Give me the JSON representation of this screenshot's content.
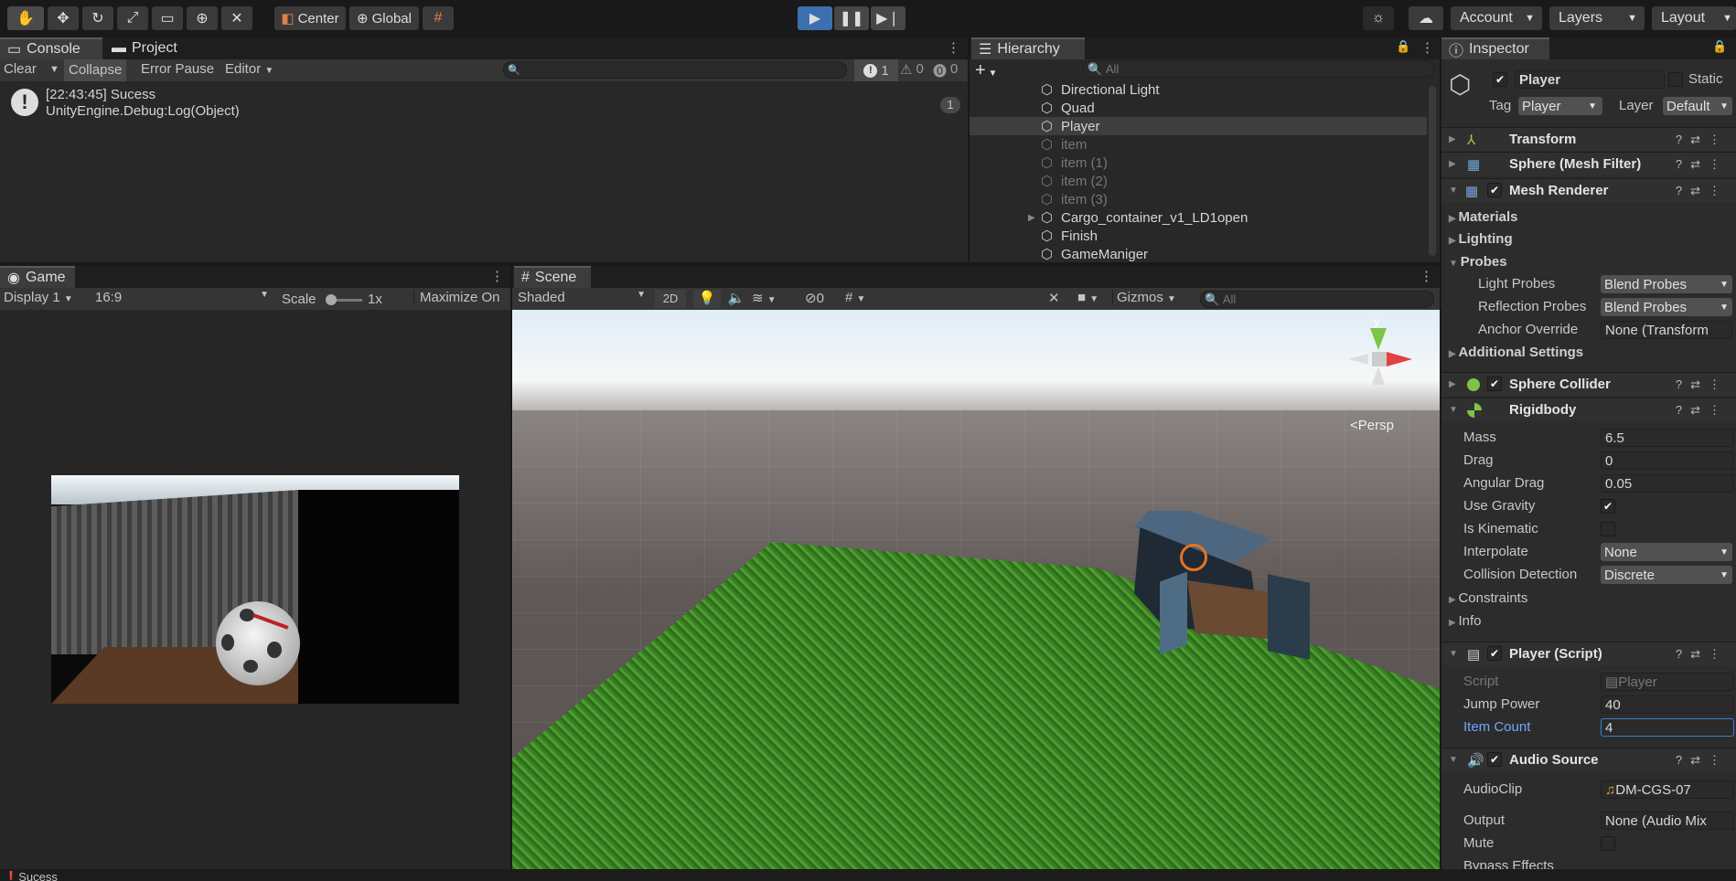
{
  "toolbar": {
    "pivot": "Center",
    "space": "Global",
    "account": "Account",
    "layers": "Layers",
    "layout": "Layout"
  },
  "console": {
    "tab": "Console",
    "project_tab": "Project",
    "clear": "Clear",
    "collapse": "Collapse",
    "error_pause": "Error Pause",
    "editor": "Editor",
    "count_log": "1",
    "count_warn": "0",
    "count_err": "0",
    "entry_line1": "[22:43:45] Sucess",
    "entry_line2": "UnityEngine.Debug:Log(Object)",
    "entry_count": "1"
  },
  "hierarchy": {
    "tab": "Hierarchy",
    "search_placeholder": "All",
    "items": [
      {
        "label": "Directional Light",
        "dim": false,
        "sel": false,
        "exp": false
      },
      {
        "label": "Quad",
        "dim": false,
        "sel": false,
        "exp": false
      },
      {
        "label": "Player",
        "dim": false,
        "sel": true,
        "exp": false
      },
      {
        "label": "item",
        "dim": true,
        "sel": false,
        "exp": false
      },
      {
        "label": "item (1)",
        "dim": true,
        "sel": false,
        "exp": false
      },
      {
        "label": "item (2)",
        "dim": true,
        "sel": false,
        "exp": false
      },
      {
        "label": "item (3)",
        "dim": true,
        "sel": false,
        "exp": false
      },
      {
        "label": "Cargo_container_v1_LD1open",
        "dim": false,
        "sel": false,
        "exp": true
      },
      {
        "label": "Finish",
        "dim": false,
        "sel": false,
        "exp": false
      },
      {
        "label": "GameManiger",
        "dim": false,
        "sel": false,
        "exp": false
      }
    ]
  },
  "game": {
    "tab": "Game",
    "display": "Display 1",
    "aspect": "16:9",
    "scale_label": "Scale",
    "scale_value": "1x",
    "maximize": "Maximize On"
  },
  "scene": {
    "tab": "Scene",
    "shading": "Shaded",
    "mode2d": "2D",
    "hidden_count": "0",
    "gizmos": "Gizmos",
    "search_placeholder": "All",
    "persp": "Persp",
    "axis_y": "y"
  },
  "inspector": {
    "tab": "Inspector",
    "name": "Player",
    "static": "Static",
    "tag_label": "Tag",
    "tag_value": "Player",
    "layer_label": "Layer",
    "layer_value": "Default",
    "components": {
      "transform": "Transform",
      "mesh_filter": "Sphere (Mesh Filter)",
      "mesh_renderer": "Mesh Renderer",
      "sphere_collider": "Sphere Collider",
      "rigidbody": "Rigidbody",
      "player_script": "Player (Script)",
      "audio_source": "Audio Source"
    },
    "mesh_renderer": {
      "materials": "Materials",
      "lighting": "Lighting",
      "probes": "Probes",
      "light_probes_label": "Light Probes",
      "light_probes_value": "Blend Probes",
      "reflection_probes_label": "Reflection Probes",
      "reflection_probes_value": "Blend Probes",
      "anchor_label": "Anchor Override",
      "anchor_value": "None (Transform",
      "additional": "Additional Settings"
    },
    "rigidbody": {
      "mass_label": "Mass",
      "mass": "6.5",
      "drag_label": "Drag",
      "drag": "0",
      "angular_drag_label": "Angular Drag",
      "angular_drag": "0.05",
      "use_gravity_label": "Use Gravity",
      "is_kinematic_label": "Is Kinematic",
      "interpolate_label": "Interpolate",
      "interpolate": "None",
      "collision_label": "Collision Detection",
      "collision": "Discrete",
      "constraints": "Constraints",
      "info": "Info"
    },
    "player_script": {
      "script_label": "Script",
      "script_value": "Player",
      "jump_label": "Jump Power",
      "jump": "40",
      "item_label": "Item Count",
      "item": "4"
    },
    "audio": {
      "clip_label": "AudioClip",
      "clip_value": "DM-CGS-07",
      "output_label": "Output",
      "output_value": "None (Audio Mix",
      "mute_label": "Mute",
      "bypass_label": "Bypass Effects"
    }
  },
  "status": {
    "text": "Sucess"
  }
}
